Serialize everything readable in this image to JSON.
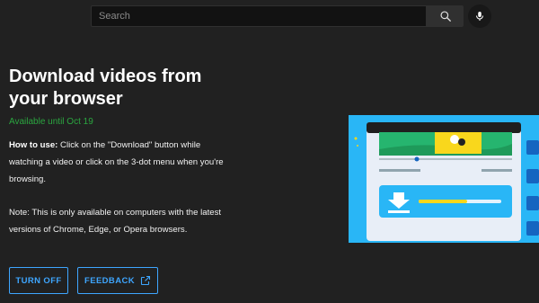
{
  "search": {
    "placeholder": "Search"
  },
  "icons": {
    "search": "search-icon",
    "mic": "mic-icon",
    "external": "open-in-new-icon"
  },
  "promo": {
    "title": "Download videos from your browser",
    "availability": "Available until Oct 19",
    "howto_label": "How to use:",
    "howto_text": " Click on the \"Download\" button while watching a video or click on the 3-dot menu when you're browsing.",
    "note": "Note: This is only available on computers with the latest versions of Chrome, Edge, or Opera browsers."
  },
  "buttons": {
    "turn_off": "TURN OFF",
    "feedback": "FEEDBACK"
  },
  "colors": {
    "background": "#212121",
    "accent_blue": "#3ea6ff",
    "available_green": "#2ba640",
    "illustration_sky": "#29b6f6",
    "illustration_yellow": "#f9d71c"
  }
}
